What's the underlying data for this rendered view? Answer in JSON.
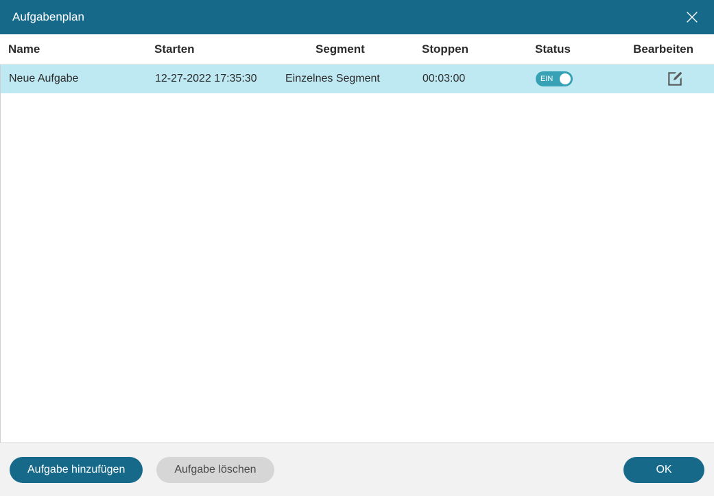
{
  "title": "Aufgabenplan",
  "columns": {
    "name": "Name",
    "start": "Starten",
    "segment": "Segment",
    "stop": "Stoppen",
    "status": "Status",
    "edit": "Bearbeiten"
  },
  "rows": [
    {
      "name": "Neue Aufgabe",
      "start": "12-27-2022 17:35:30",
      "segment": "Einzelnes Segment",
      "stop": "00:03:00",
      "status_label": "EIN",
      "status_on": true
    }
  ],
  "footer": {
    "add": "Aufgabe hinzufügen",
    "delete": "Aufgabe löschen",
    "ok": "OK"
  }
}
